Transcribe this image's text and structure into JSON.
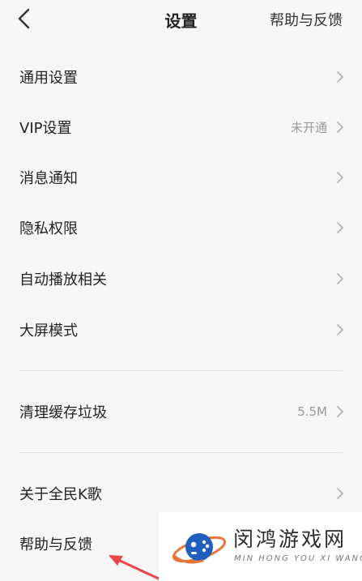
{
  "header": {
    "title": "设置",
    "right_link": "帮助与反馈",
    "back_icon": "chevron-left-icon"
  },
  "settings": {
    "general": {
      "label": "通用设置"
    },
    "vip": {
      "label": "VIP设置",
      "value": "未开通"
    },
    "notifications": {
      "label": "消息通知"
    },
    "privacy": {
      "label": "隐私权限"
    },
    "autoplay": {
      "label": "自动播放相关"
    },
    "big_screen": {
      "label": "大屏模式"
    },
    "clear_cache": {
      "label": "清理缓存垃圾",
      "value": "5.5M"
    },
    "about": {
      "label": "关于全民K歌"
    },
    "help": {
      "label": "帮助与反馈"
    }
  },
  "watermark": {
    "title": "闵鸿游戏网",
    "subtitle": "MIN HONG YOU XI WANG"
  },
  "colors": {
    "background": "#f6f6f6",
    "text": "#222222",
    "secondary": "#9a9a9a",
    "annotation_arrow": "#e8464b"
  }
}
